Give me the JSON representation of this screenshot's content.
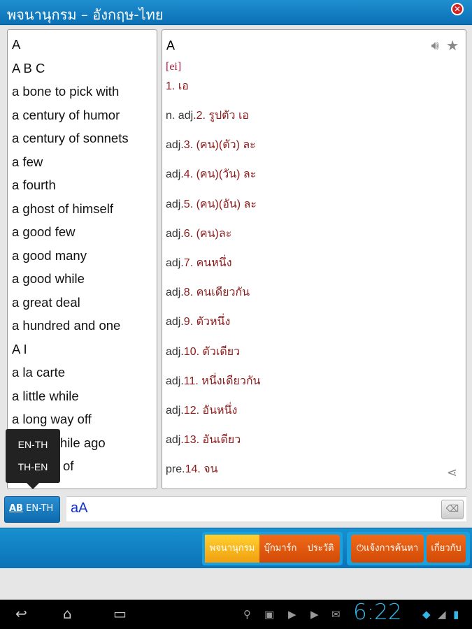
{
  "title": "พจนานุกรม – อังกฤษ-ไทย",
  "word_list": [
    "A",
    "A B C",
    "a bone to pick with",
    "a century of humor",
    "a century of sonnets",
    "a few",
    "a fourth",
    "a ghost of himself",
    "a good few",
    "a good many",
    "a good while",
    "a great deal",
    "a hundred and one",
    "A I",
    "a la carte",
    "a little while",
    "a long way off",
    "a long while ago",
    "a matter of"
  ],
  "entry": {
    "headword": "A",
    "phonetic": "[ei]",
    "definitions": [
      {
        "pos": "",
        "text": "1. เอ"
      },
      {
        "pos": "n. adj.",
        "text": "2. รูปตัว เอ"
      },
      {
        "pos": "adj.",
        "text": "3. (คน)(ตัว) ละ"
      },
      {
        "pos": "adj.",
        "text": "4. (คน)(วัน) ละ"
      },
      {
        "pos": "adj.",
        "text": "5. (คน)(อัน) ละ"
      },
      {
        "pos": "adj.",
        "text": "6. (คน)ละ"
      },
      {
        "pos": "adj.",
        "text": "7. คนหนึ่ง"
      },
      {
        "pos": "adj.",
        "text": "8. คนเดียวกัน"
      },
      {
        "pos": "adj.",
        "text": "9. ตัวหนึ่ง"
      },
      {
        "pos": "adj.",
        "text": "10. ตัวเดียว"
      },
      {
        "pos": "adj.",
        "text": "11. หนึ่งเดียวกัน"
      },
      {
        "pos": "adj.",
        "text": "12. อันหนึ่ง"
      },
      {
        "pos": "adj.",
        "text": "13. อันเดียว"
      },
      {
        "pos": "pre.",
        "text": "14. จน"
      }
    ]
  },
  "lang_popup": [
    "EN-TH",
    "TH-EN"
  ],
  "lang_button": "EN-TH",
  "search": {
    "value": "aA"
  },
  "tabs": [
    "พจนานุกรม",
    "บุ๊กมาร์ก",
    "ประวัติ"
  ],
  "active_tab": 0,
  "report_button": "แจ้งการค้นหา",
  "about_button": "เกี่ยวกับ",
  "status": {
    "time": "6:22"
  },
  "colors": {
    "accent": "#0b72b8",
    "tab_active": "#f0a010",
    "tab": "#e05a10",
    "definition": "#8b1a1a"
  }
}
